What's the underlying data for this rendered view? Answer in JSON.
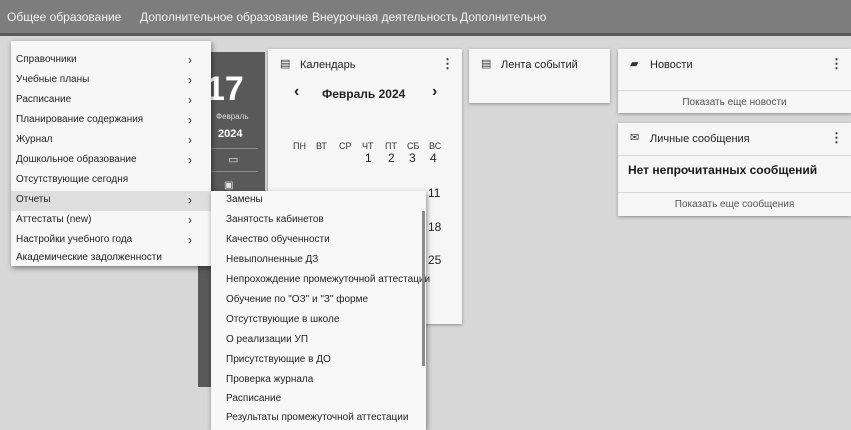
{
  "top_nav": [
    {
      "label": "Общее образование"
    },
    {
      "label": "Дополнительное образование"
    },
    {
      "label": "Внеурочная деятельность"
    },
    {
      "label": "Дополнительно"
    }
  ],
  "menu": {
    "items": [
      {
        "label": "Справочники",
        "has_submenu": true
      },
      {
        "label": "Учебные планы",
        "has_submenu": true
      },
      {
        "label": "Расписание",
        "has_submenu": true
      },
      {
        "label": "Планирование содержания",
        "has_submenu": true
      },
      {
        "label": "Журнал",
        "has_submenu": true
      },
      {
        "label": "Дошкольное образование",
        "has_submenu": true
      },
      {
        "label": "Отсутствующие сегодня",
        "has_submenu": false
      },
      {
        "label": "Отчеты",
        "has_submenu": true
      },
      {
        "label": "Аттестаты (new)",
        "has_submenu": true
      },
      {
        "label": "Настройки учебного года",
        "has_submenu": true
      },
      {
        "label": "Академические задолженности",
        "has_submenu": false
      }
    ],
    "chevron": "›"
  },
  "submenu": {
    "items": [
      "Замены",
      "Занятость кабинетов",
      "Качество обученности",
      "Невыполненные ДЗ",
      "Непрохождение промежуточной аттестации",
      "Обучение по \"ОЗ\" и \"З\" форме",
      "Отсутствующие в школе",
      "О реализации УП",
      "Присутствующие в ДО",
      "Проверка журнала",
      "Расписание",
      "Результаты промежуточной аттестации"
    ]
  },
  "calendar": {
    "title": "Календарь",
    "icon": "calendar-icon",
    "big_day": "17",
    "big_month": "Февраль",
    "big_year": "2024",
    "month_label": "Февраль 2024",
    "prev": "‹",
    "next": "›",
    "weekdays": [
      "ПН",
      "ВТ",
      "СР",
      "ЧТ",
      "ПТ",
      "СБ",
      "ВС"
    ],
    "week1": [
      "1",
      "2",
      "3",
      "4"
    ],
    "right_col": [
      "11",
      "18",
      "25"
    ],
    "more": "⋮"
  },
  "events": {
    "title": "Лента событий",
    "icon": "calendar-icon"
  },
  "news": {
    "title": "Новости",
    "icon": "chat-icon",
    "show_more": "Показать еще новости",
    "more": "⋮"
  },
  "messages": {
    "title": "Личные сообщения",
    "icon": "mail-icon",
    "empty": "Нет непрочитанных сообщений",
    "show_more": "Показать еще сообщения",
    "more": "⋮"
  }
}
